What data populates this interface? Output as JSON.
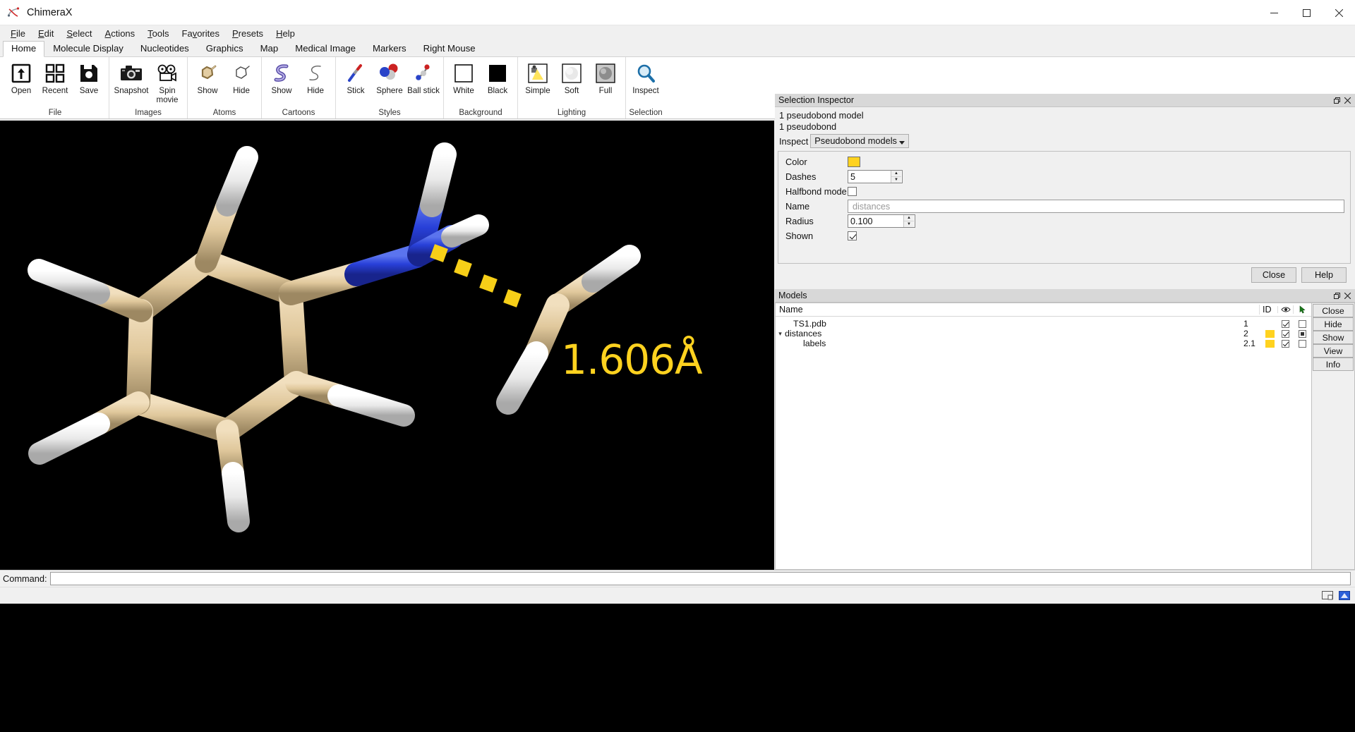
{
  "window": {
    "title": "ChimeraX",
    "icon": "chimerax-logo-icon",
    "minimize": "–",
    "maximize": "☐",
    "close": "✕"
  },
  "menubar": {
    "items": [
      {
        "label": "File",
        "mnemonic": "F"
      },
      {
        "label": "Edit",
        "mnemonic": "E"
      },
      {
        "label": "Select",
        "mnemonic": "S"
      },
      {
        "label": "Actions",
        "mnemonic": "A"
      },
      {
        "label": "Tools",
        "mnemonic": "T"
      },
      {
        "label": "Favorites",
        "mnemonic": "v"
      },
      {
        "label": "Presets",
        "mnemonic": "P"
      },
      {
        "label": "Help",
        "mnemonic": "H"
      }
    ]
  },
  "ribbon": {
    "tabs": [
      {
        "label": "Home",
        "active": true
      },
      {
        "label": "Molecule Display",
        "active": false
      },
      {
        "label": "Nucleotides",
        "active": false
      },
      {
        "label": "Graphics",
        "active": false
      },
      {
        "label": "Map",
        "active": false
      },
      {
        "label": "Medical Image",
        "active": false
      },
      {
        "label": "Markers",
        "active": false
      },
      {
        "label": "Right Mouse",
        "active": false
      }
    ],
    "groups": [
      {
        "name": "File",
        "buttons": [
          {
            "label": "Open",
            "icon": "open-folder-arrow-icon"
          },
          {
            "label": "Recent",
            "icon": "recent-grid-icon"
          },
          {
            "label": "Save",
            "icon": "save-floppy-icon"
          }
        ]
      },
      {
        "name": "Images",
        "buttons": [
          {
            "label": "Snapshot",
            "icon": "camera-icon"
          },
          {
            "label": "Spin movie",
            "icon": "movie-camera-icon"
          }
        ]
      },
      {
        "name": "Atoms",
        "buttons": [
          {
            "label": "Show",
            "icon": "atoms-show-icon"
          },
          {
            "label": "Hide",
            "icon": "atoms-hide-icon"
          }
        ]
      },
      {
        "name": "Cartoons",
        "buttons": [
          {
            "label": "Show",
            "icon": "cartoon-show-icon"
          },
          {
            "label": "Hide",
            "icon": "cartoon-hide-icon"
          }
        ]
      },
      {
        "name": "Styles",
        "buttons": [
          {
            "label": "Stick",
            "icon": "stick-style-icon"
          },
          {
            "label": "Sphere",
            "icon": "sphere-style-icon"
          },
          {
            "label": "Ball stick",
            "icon": "ball-stick-style-icon"
          }
        ]
      },
      {
        "name": "Background",
        "buttons": [
          {
            "label": "White",
            "icon": "white-swatch-icon"
          },
          {
            "label": "Black",
            "icon": "black-swatch-icon"
          }
        ]
      },
      {
        "name": "Lighting",
        "buttons": [
          {
            "label": "Simple",
            "icon": "lighting-simple-icon"
          },
          {
            "label": "Soft",
            "icon": "lighting-soft-icon"
          },
          {
            "label": "Full",
            "icon": "lighting-full-icon"
          }
        ]
      },
      {
        "name": "Selection",
        "buttons": [
          {
            "label": "Inspect",
            "icon": "magnifier-inspect-icon"
          }
        ]
      }
    ]
  },
  "viewport": {
    "background_color": "#000000",
    "distance_label": "1.606Å",
    "label_color": "#ffd21f",
    "atom_colors": {
      "carbon": "#e0c9a0",
      "hydrogen": "#ffffff",
      "nitrogen": "#2038d8",
      "pseudobond": "#ffd21f"
    }
  },
  "inspector": {
    "title": "Selection Inspector",
    "float_icon": "restore-window-icon",
    "close_icon": "close-icon",
    "summary_line1": "1 pseudobond model",
    "summary_line2": "1 pseudobond",
    "inspect_label": "Inspect",
    "inspect_value": "Pseudobond models",
    "fields": [
      {
        "label": "Color",
        "type": "color",
        "value": "#ffd21f"
      },
      {
        "label": "Dashes",
        "type": "spin",
        "value": "5"
      },
      {
        "label": "Halfbond mode",
        "type": "checkbox",
        "checked": false
      },
      {
        "label": "Name",
        "type": "text",
        "value": "",
        "placeholder": "distances"
      },
      {
        "label": "Radius",
        "type": "spin",
        "value": "0.100"
      },
      {
        "label": "Shown",
        "type": "checkbox",
        "checked": true
      }
    ],
    "close_button": "Close",
    "help_button": "Help"
  },
  "models": {
    "title": "Models",
    "float_icon": "restore-window-icon",
    "close_icon": "close-icon",
    "columns": {
      "name": "Name",
      "id": "ID",
      "shown": "eye-icon",
      "select": "select-pointer-icon"
    },
    "rows": [
      {
        "name": "TS1.pdb",
        "id": "1",
        "indent": 2,
        "twisty": "",
        "color": "",
        "shown": true,
        "selected": false,
        "select_mark": "empty"
      },
      {
        "name": "distances",
        "id": "2",
        "indent": 1,
        "twisty": "▾",
        "color": "#ffd21f",
        "shown": true,
        "selected": true,
        "select_mark": "filled"
      },
      {
        "name": "labels",
        "id": "2.1",
        "indent": 3,
        "twisty": "",
        "color": "#ffd21f",
        "shown": true,
        "selected": false,
        "select_mark": "empty"
      }
    ],
    "buttons": [
      {
        "label": "Close"
      },
      {
        "label": "Hide"
      },
      {
        "label": "Show"
      },
      {
        "label": "View"
      },
      {
        "label": "Info"
      }
    ]
  },
  "command": {
    "label": "Command:",
    "value": "",
    "placeholder": ""
  },
  "statusbar": {
    "icons": [
      {
        "name": "display-toggle-icon"
      },
      {
        "name": "blue-square-icon",
        "color": "#2b5fd9"
      }
    ]
  }
}
